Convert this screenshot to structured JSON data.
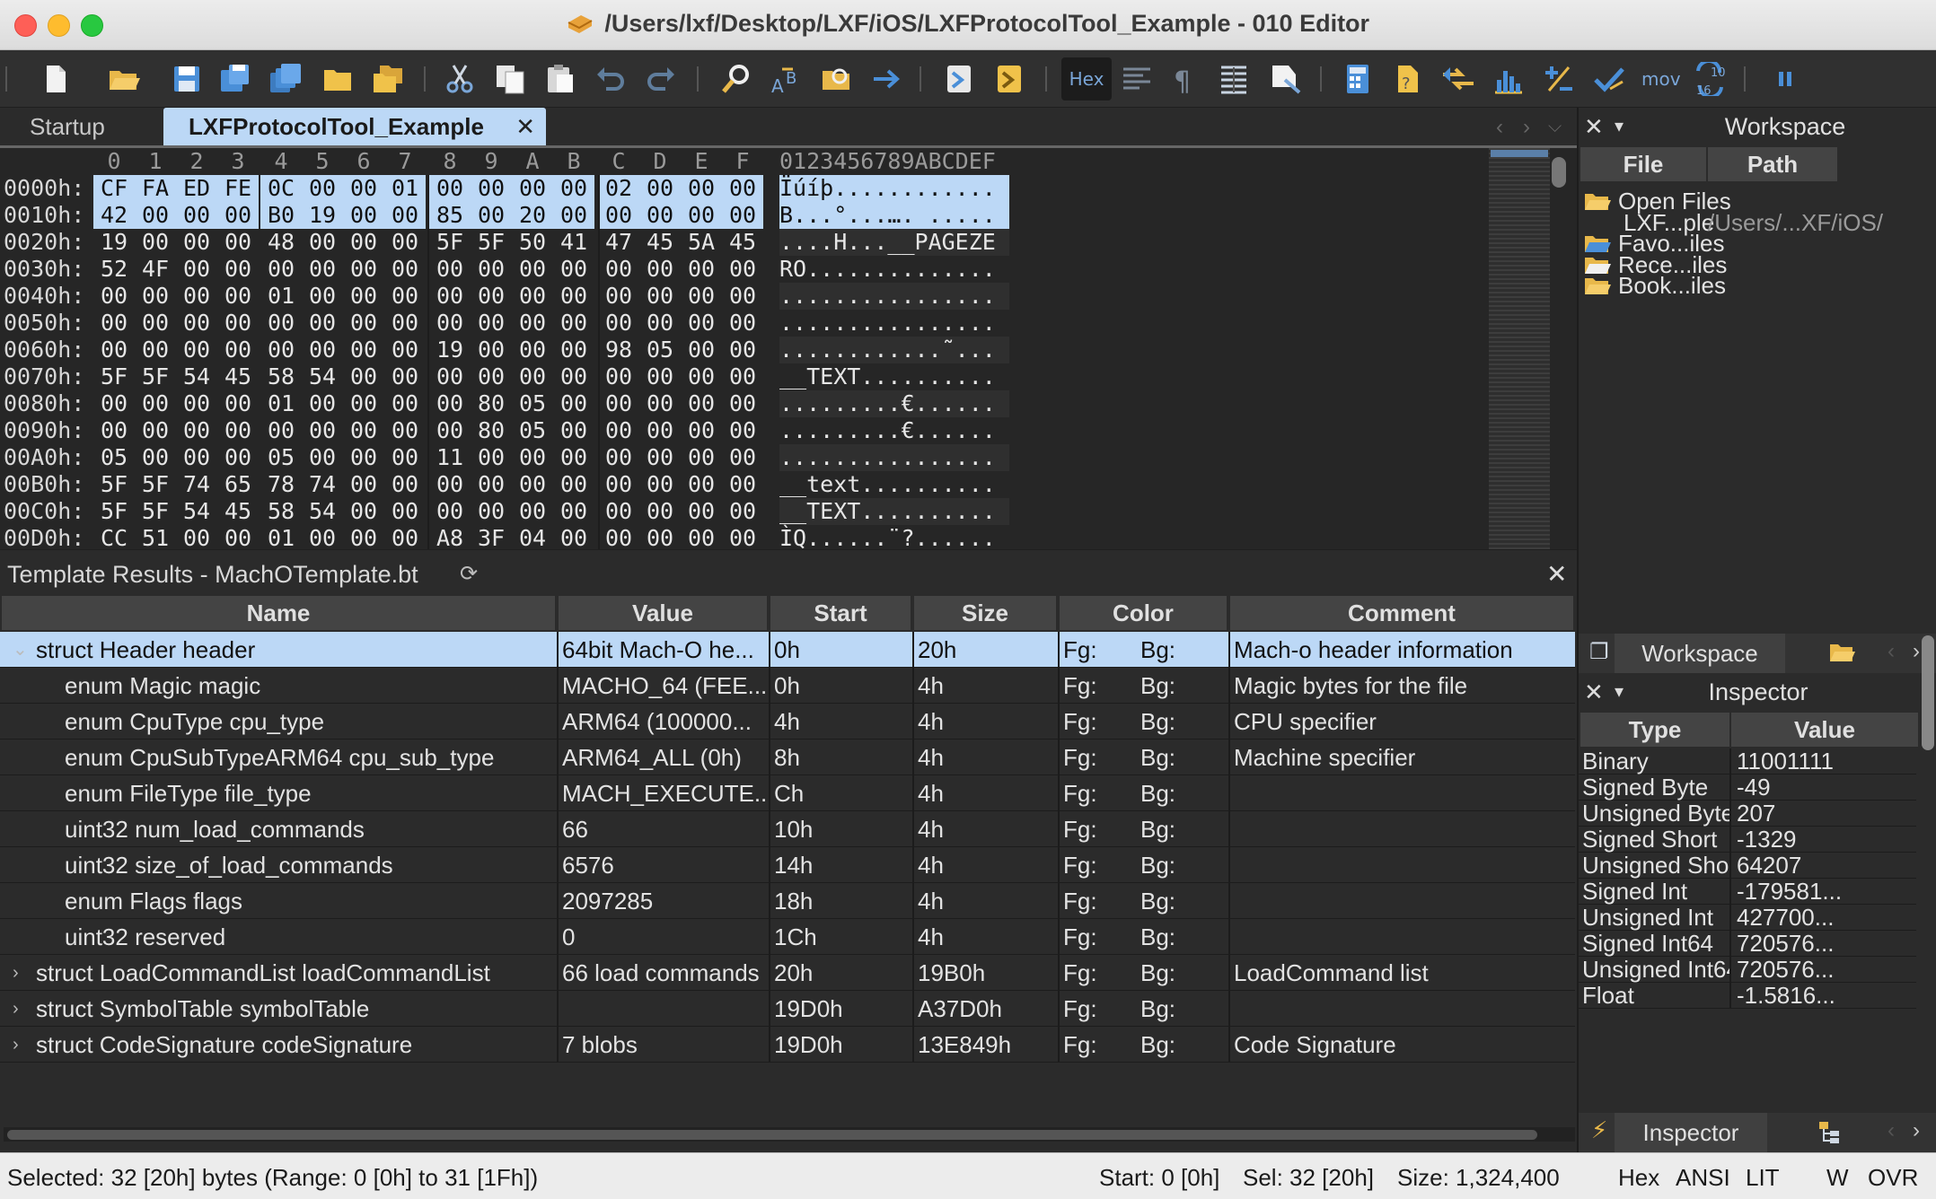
{
  "window": {
    "title": "/Users/lxf/Desktop/LXF/iOS/LXFProtocolTool_Example - 010 Editor"
  },
  "toolbar": {
    "hex_label": "Hex",
    "mov_label": "mov",
    "base_label_top": "10",
    "base_label_bottom": "16"
  },
  "tabs": [
    {
      "label": "Startup",
      "active": false
    },
    {
      "label": "LXFProtocolTool_Example",
      "active": true
    }
  ],
  "hex": {
    "columns": [
      "0",
      "1",
      "2",
      "3",
      "4",
      "5",
      "6",
      "7",
      "8",
      "9",
      "A",
      "B",
      "C",
      "D",
      "E",
      "F"
    ],
    "ascii_header": "0123456789ABCDEF",
    "rows": [
      {
        "addr": "0000h:",
        "bytes": [
          "CF",
          "FA",
          "ED",
          "FE",
          "0C",
          "00",
          "00",
          "01",
          "00",
          "00",
          "00",
          "00",
          "02",
          "00",
          "00",
          "00"
        ],
        "ascii": "Ïúíþ............",
        "selected": true
      },
      {
        "addr": "0010h:",
        "bytes": [
          "42",
          "00",
          "00",
          "00",
          "B0",
          "19",
          "00",
          "00",
          "85",
          "00",
          "20",
          "00",
          "00",
          "00",
          "00",
          "00"
        ],
        "ascii": "B...°...…. .....",
        "selected": true
      },
      {
        "addr": "0020h:",
        "bytes": [
          "19",
          "00",
          "00",
          "00",
          "48",
          "00",
          "00",
          "00",
          "5F",
          "5F",
          "50",
          "41",
          "47",
          "45",
          "5A",
          "45"
        ],
        "ascii": "....H...__PAGEZE"
      },
      {
        "addr": "0030h:",
        "bytes": [
          "52",
          "4F",
          "00",
          "00",
          "00",
          "00",
          "00",
          "00",
          "00",
          "00",
          "00",
          "00",
          "00",
          "00",
          "00",
          "00"
        ],
        "ascii": "RO.............."
      },
      {
        "addr": "0040h:",
        "bytes": [
          "00",
          "00",
          "00",
          "00",
          "01",
          "00",
          "00",
          "00",
          "00",
          "00",
          "00",
          "00",
          "00",
          "00",
          "00",
          "00"
        ],
        "ascii": "................"
      },
      {
        "addr": "0050h:",
        "bytes": [
          "00",
          "00",
          "00",
          "00",
          "00",
          "00",
          "00",
          "00",
          "00",
          "00",
          "00",
          "00",
          "00",
          "00",
          "00",
          "00"
        ],
        "ascii": "................"
      },
      {
        "addr": "0060h:",
        "bytes": [
          "00",
          "00",
          "00",
          "00",
          "00",
          "00",
          "00",
          "00",
          "19",
          "00",
          "00",
          "00",
          "98",
          "05",
          "00",
          "00"
        ],
        "ascii": "............˜..."
      },
      {
        "addr": "0070h:",
        "bytes": [
          "5F",
          "5F",
          "54",
          "45",
          "58",
          "54",
          "00",
          "00",
          "00",
          "00",
          "00",
          "00",
          "00",
          "00",
          "00",
          "00"
        ],
        "ascii": "__TEXT.........."
      },
      {
        "addr": "0080h:",
        "bytes": [
          "00",
          "00",
          "00",
          "00",
          "01",
          "00",
          "00",
          "00",
          "00",
          "80",
          "05",
          "00",
          "00",
          "00",
          "00",
          "00"
        ],
        "ascii": ".........€......"
      },
      {
        "addr": "0090h:",
        "bytes": [
          "00",
          "00",
          "00",
          "00",
          "00",
          "00",
          "00",
          "00",
          "00",
          "80",
          "05",
          "00",
          "00",
          "00",
          "00",
          "00"
        ],
        "ascii": ".........€......"
      },
      {
        "addr": "00A0h:",
        "bytes": [
          "05",
          "00",
          "00",
          "00",
          "05",
          "00",
          "00",
          "00",
          "11",
          "00",
          "00",
          "00",
          "00",
          "00",
          "00",
          "00"
        ],
        "ascii": "................"
      },
      {
        "addr": "00B0h:",
        "bytes": [
          "5F",
          "5F",
          "74",
          "65",
          "78",
          "74",
          "00",
          "00",
          "00",
          "00",
          "00",
          "00",
          "00",
          "00",
          "00",
          "00"
        ],
        "ascii": "__text.........."
      },
      {
        "addr": "00C0h:",
        "bytes": [
          "5F",
          "5F",
          "54",
          "45",
          "58",
          "54",
          "00",
          "00",
          "00",
          "00",
          "00",
          "00",
          "00",
          "00",
          "00",
          "00"
        ],
        "ascii": "__TEXT.........."
      },
      {
        "addr": "00D0h:",
        "bytes": [
          "CC",
          "51",
          "00",
          "00",
          "01",
          "00",
          "00",
          "00",
          "A8",
          "3F",
          "04",
          "00",
          "00",
          "00",
          "00",
          "00"
        ],
        "ascii": "ÌQ......¨?......"
      }
    ]
  },
  "template": {
    "title": "Template Results - MachOTemplate.bt",
    "headers": [
      "Name",
      "Value",
      "Start",
      "Size",
      "Color",
      "Comment"
    ],
    "rows": [
      {
        "expander": "⌄",
        "name": "struct Header header",
        "value": "64bit Mach-O he...",
        "start": "0h",
        "size": "20h",
        "fg": "Fg:",
        "bg": "Bg:",
        "comment": "Mach-o header information",
        "selected": true,
        "indent": 0
      },
      {
        "expander": "",
        "name": "enum Magic magic",
        "value": "MACHO_64 (FEE...",
        "start": "0h",
        "size": "4h",
        "fg": "Fg:",
        "bg": "Bg:",
        "comment": "Magic bytes for the file",
        "indent": 1
      },
      {
        "expander": "",
        "name": "enum CpuType cpu_type",
        "value": "ARM64 (100000...",
        "start": "4h",
        "size": "4h",
        "fg": "Fg:",
        "bg": "Bg:",
        "comment": "CPU specifier",
        "indent": 1
      },
      {
        "expander": "",
        "name": "enum CpuSubTypeARM64 cpu_sub_type",
        "value": "ARM64_ALL (0h)",
        "start": "8h",
        "size": "4h",
        "fg": "Fg:",
        "bg": "Bg:",
        "comment": "Machine specifier",
        "indent": 1
      },
      {
        "expander": "",
        "name": "enum FileType file_type",
        "value": "MACH_EXECUTE...",
        "start": "Ch",
        "size": "4h",
        "fg": "Fg:",
        "bg": "Bg:",
        "comment": "",
        "indent": 1
      },
      {
        "expander": "",
        "name": "uint32 num_load_commands",
        "value": "66",
        "start": "10h",
        "size": "4h",
        "fg": "Fg:",
        "bg": "Bg:",
        "comment": "",
        "indent": 1
      },
      {
        "expander": "",
        "name": "uint32 size_of_load_commands",
        "value": "6576",
        "start": "14h",
        "size": "4h",
        "fg": "Fg:",
        "bg": "Bg:",
        "comment": "",
        "indent": 1
      },
      {
        "expander": "",
        "name": "enum Flags flags",
        "value": "2097285",
        "start": "18h",
        "size": "4h",
        "fg": "Fg:",
        "bg": "Bg:",
        "comment": "",
        "indent": 1
      },
      {
        "expander": "",
        "name": "uint32 reserved",
        "value": "0",
        "start": "1Ch",
        "size": "4h",
        "fg": "Fg:",
        "bg": "Bg:",
        "comment": "",
        "indent": 1
      },
      {
        "expander": "›",
        "name": "struct LoadCommandList loadCommandList",
        "value": "66 load commands",
        "start": "20h",
        "size": "19B0h",
        "fg": "Fg:",
        "bg": "Bg:",
        "comment": "LoadCommand list",
        "indent": 0
      },
      {
        "expander": "›",
        "name": "struct SymbolTable symbolTable",
        "value": "",
        "start": "19D0h",
        "size": "A37D0h",
        "fg": "Fg:",
        "bg": "Bg:",
        "comment": "",
        "indent": 0
      },
      {
        "expander": "›",
        "name": "struct CodeSignature codeSignature",
        "value": "7 blobs",
        "start": "19D0h",
        "size": "13E849h",
        "fg": "Fg:",
        "bg": "Bg:",
        "comment": "Code Signature",
        "indent": 0
      }
    ]
  },
  "workspace": {
    "title": "Workspace",
    "headers": [
      "File",
      "Path"
    ],
    "items": [
      {
        "label": "Open Files",
        "path": "",
        "level": 0,
        "icon": "folder-open-icon"
      },
      {
        "label": "LXF...ple",
        "path": "/Users/...XF/iOS/",
        "level": 1,
        "icon": ""
      },
      {
        "label": "Favo...iles",
        "path": "",
        "level": 0,
        "icon": "star-folder-icon"
      },
      {
        "label": "Rece...iles",
        "path": "",
        "level": 0,
        "icon": "recent-folder-icon"
      },
      {
        "label": "Book...iles",
        "path": "",
        "level": 0,
        "icon": "bookmark-folder-icon"
      }
    ],
    "dock_tab": "Workspace"
  },
  "inspector": {
    "title": "Inspector",
    "headers": [
      "Type",
      "Value"
    ],
    "rows": [
      {
        "type": "Binary",
        "value": "11001111"
      },
      {
        "type": "Signed Byte",
        "value": "-49"
      },
      {
        "type": "Unsigned Byte",
        "value": "207"
      },
      {
        "type": "Signed Short",
        "value": "-1329"
      },
      {
        "type": "Unsigned Short",
        "value": "64207"
      },
      {
        "type": "Signed Int",
        "value": "-179581..."
      },
      {
        "type": "Unsigned Int",
        "value": "427700..."
      },
      {
        "type": "Signed Int64",
        "value": "720576..."
      },
      {
        "type": "Unsigned Int64",
        "value": "720576..."
      },
      {
        "type": "Float",
        "value": "-1.5816..."
      }
    ],
    "dock_tab": "Inspector"
  },
  "status": {
    "selected": "Selected: 32 [20h] bytes (Range: 0 [0h] to 31 [1Fh])",
    "start": "Start: 0 [0h]",
    "sel": "Sel: 32 [20h]",
    "size": "Size: 1,324,400",
    "mode": "Hex",
    "charset": "ANSI",
    "endian": "LIT",
    "w": "W",
    "ovr": "OVR"
  },
  "colors": {
    "selection": "#bcd8f6",
    "accent": "#7aa6d8",
    "folder": "#e8b84a"
  }
}
